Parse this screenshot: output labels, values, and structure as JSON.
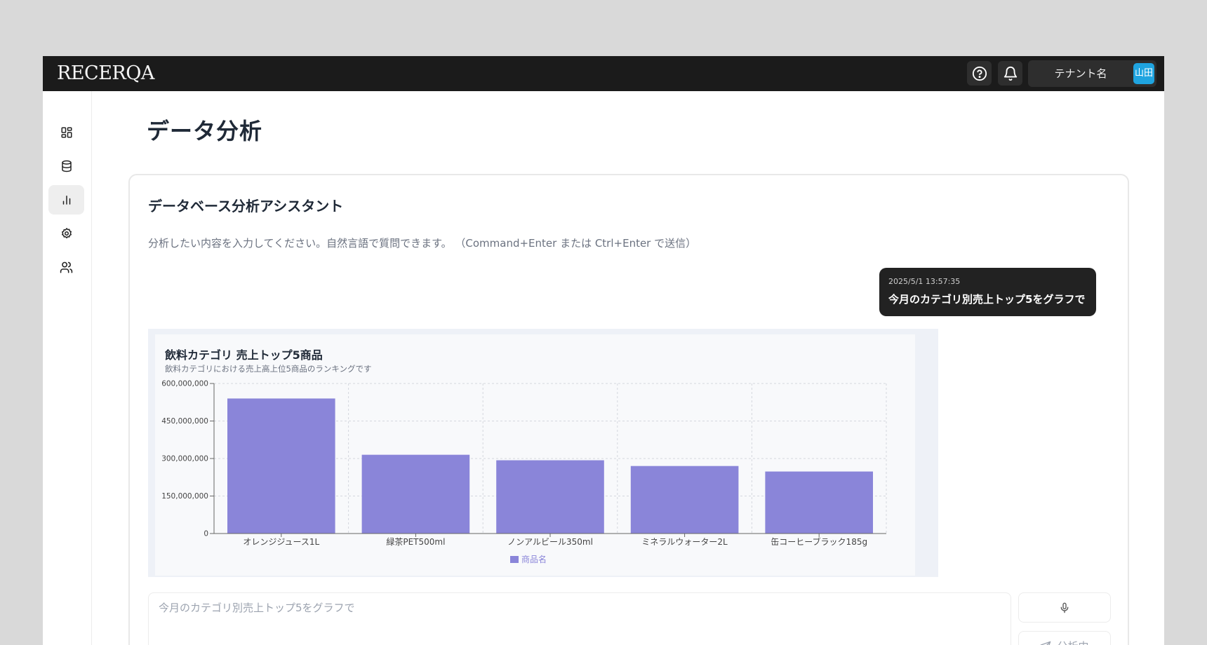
{
  "topbar": {
    "logo": "RECERQA",
    "tenant_name": "テナント名",
    "avatar": "山田",
    "icons": [
      "help-circle-icon",
      "bell-icon"
    ]
  },
  "sidebar": {
    "items": [
      {
        "icon": "dashboard-icon",
        "active": false
      },
      {
        "icon": "database-icon",
        "active": false
      },
      {
        "icon": "bar-chart-icon",
        "active": true
      },
      {
        "icon": "gear-icon",
        "active": false
      },
      {
        "icon": "users-icon",
        "active": false
      }
    ]
  },
  "page": {
    "title": "データ分析"
  },
  "assistant": {
    "title": "データベース分析アシスタント",
    "description": "分析したい内容を入力してください。自然言語で質問できます。 （Command+Enter または Ctrl+Enter で送信）",
    "message": {
      "timestamp": "2025/5/1 13:57:35",
      "text": "今月のカテゴリ別売上トップ5をグラフで"
    },
    "input_placeholder": "今月のカテゴリ別売上トップ5をグラフで",
    "send_label": "分析中"
  },
  "chart_data": {
    "type": "bar",
    "title": "飲料カテゴリ 売上トップ5商品",
    "subtitle": "飲料カテゴリにおける売上高上位5商品のランキングです",
    "categories": [
      "オレンジジュース1L",
      "緑茶PET500ml",
      "ノンアルビール350ml",
      "ミネラルウォーター2L",
      "缶コーヒーブラック185g"
    ],
    "series": [
      {
        "name": "商品名",
        "values": [
          540000000,
          315000000,
          293000000,
          270000000,
          248000000
        ]
      }
    ],
    "yticks": [
      0,
      150000000,
      300000000,
      450000000,
      600000000
    ],
    "ytick_labels": [
      "0",
      "150,000,000",
      "300,000,000",
      "450,000,000",
      "600,000,000"
    ],
    "ylim": [
      0,
      600000000
    ],
    "grid": true,
    "legend_position": "bottom",
    "bar_color": "#8a85d9"
  }
}
